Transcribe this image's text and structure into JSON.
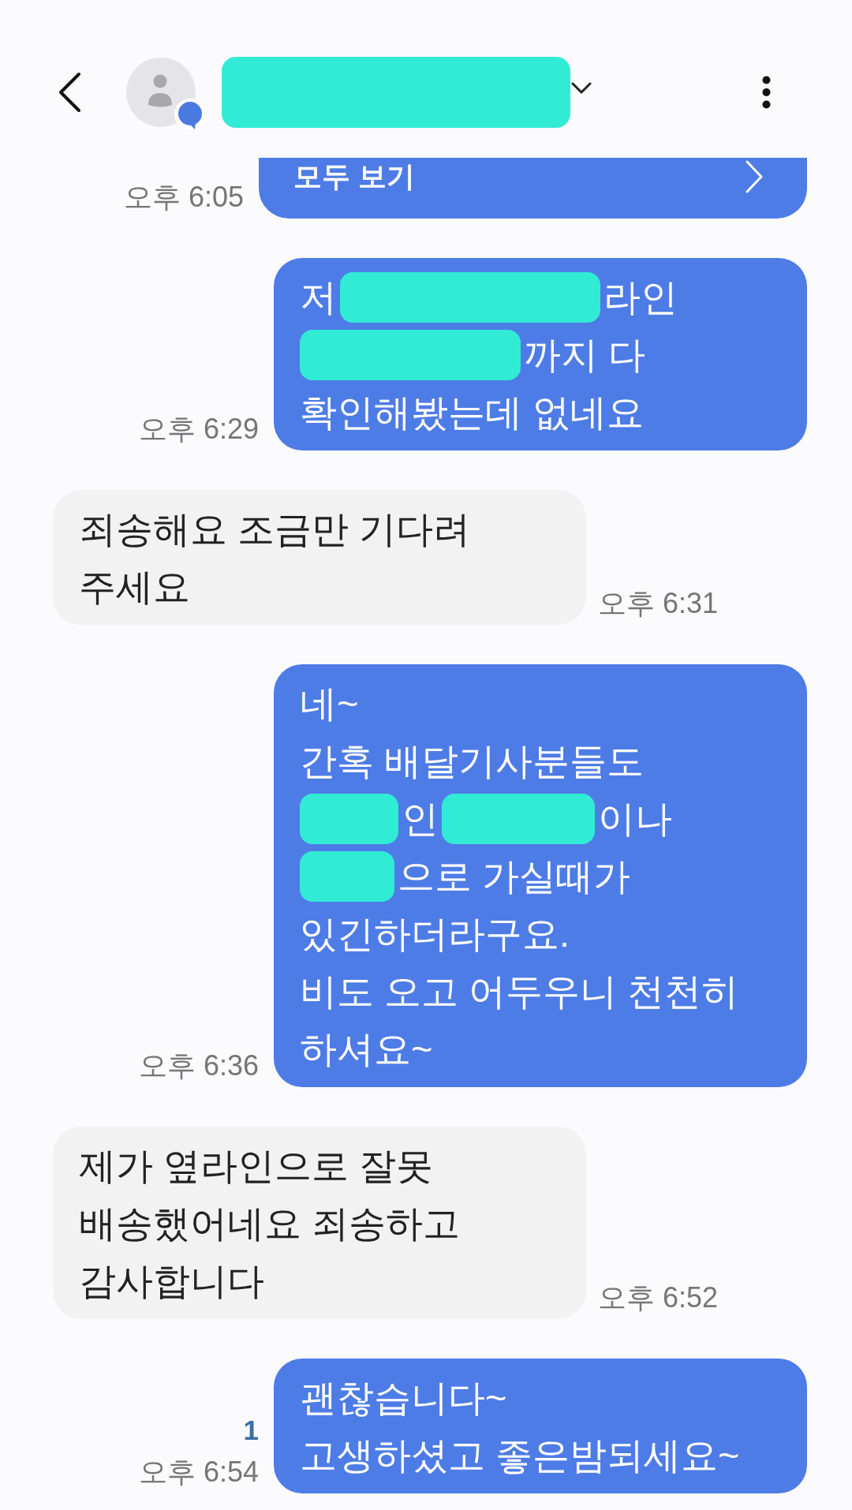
{
  "header": {
    "title": [
      {
        "kind": "redaction"
      }
    ]
  },
  "messages": [
    {
      "kind": "link_card",
      "outgoing": true,
      "label": "모두 보기",
      "time": "오후 6:05"
    },
    {
      "kind": "redacted_text",
      "outgoing": true,
      "lines": [
        [
          {
            "kind": "text",
            "text": "저"
          },
          {
            "kind": "redaction"
          },
          {
            "kind": "text",
            "text": "라인"
          }
        ],
        [
          {
            "kind": "redaction"
          },
          {
            "kind": "text",
            "text": "까지 다"
          }
        ],
        [
          {
            "kind": "text",
            "text": "확인해봤는데 없네요"
          }
        ]
      ],
      "time": "오후 6:29"
    },
    {
      "kind": "text",
      "outgoing": false,
      "text": "죄송해요 조금만 기다려\n주세요",
      "time": "오후 6:31"
    },
    {
      "kind": "redacted_text",
      "outgoing": true,
      "lines": [
        [
          {
            "kind": "text",
            "text": "네~"
          }
        ],
        [
          {
            "kind": "text",
            "text": "간혹 배달기사분들도"
          }
        ],
        [
          {
            "kind": "redaction"
          },
          {
            "kind": "text",
            "text": "인"
          },
          {
            "kind": "redaction"
          },
          {
            "kind": "text",
            "text": "이나"
          }
        ],
        [
          {
            "kind": "redaction"
          },
          {
            "kind": "text",
            "text": "으로 가실때가"
          }
        ],
        [
          {
            "kind": "text",
            "text": "있긴하더라구요."
          }
        ],
        [
          {
            "kind": "text",
            "text": "비도 오고 어두우니 천천히"
          }
        ],
        [
          {
            "kind": "text",
            "text": "하셔요~"
          }
        ]
      ],
      "time": "오후 6:36"
    },
    {
      "kind": "text",
      "outgoing": false,
      "text": "제가 옆라인으로 잘못\n배송했어네요 죄송하고\n감사합니다",
      "time": "오후 6:52"
    },
    {
      "kind": "text",
      "outgoing": true,
      "text": "괜찮습니다~\n고생하셨고 좋은밤되세요~",
      "time": "오후 6:54",
      "unread_count": "1"
    }
  ]
}
